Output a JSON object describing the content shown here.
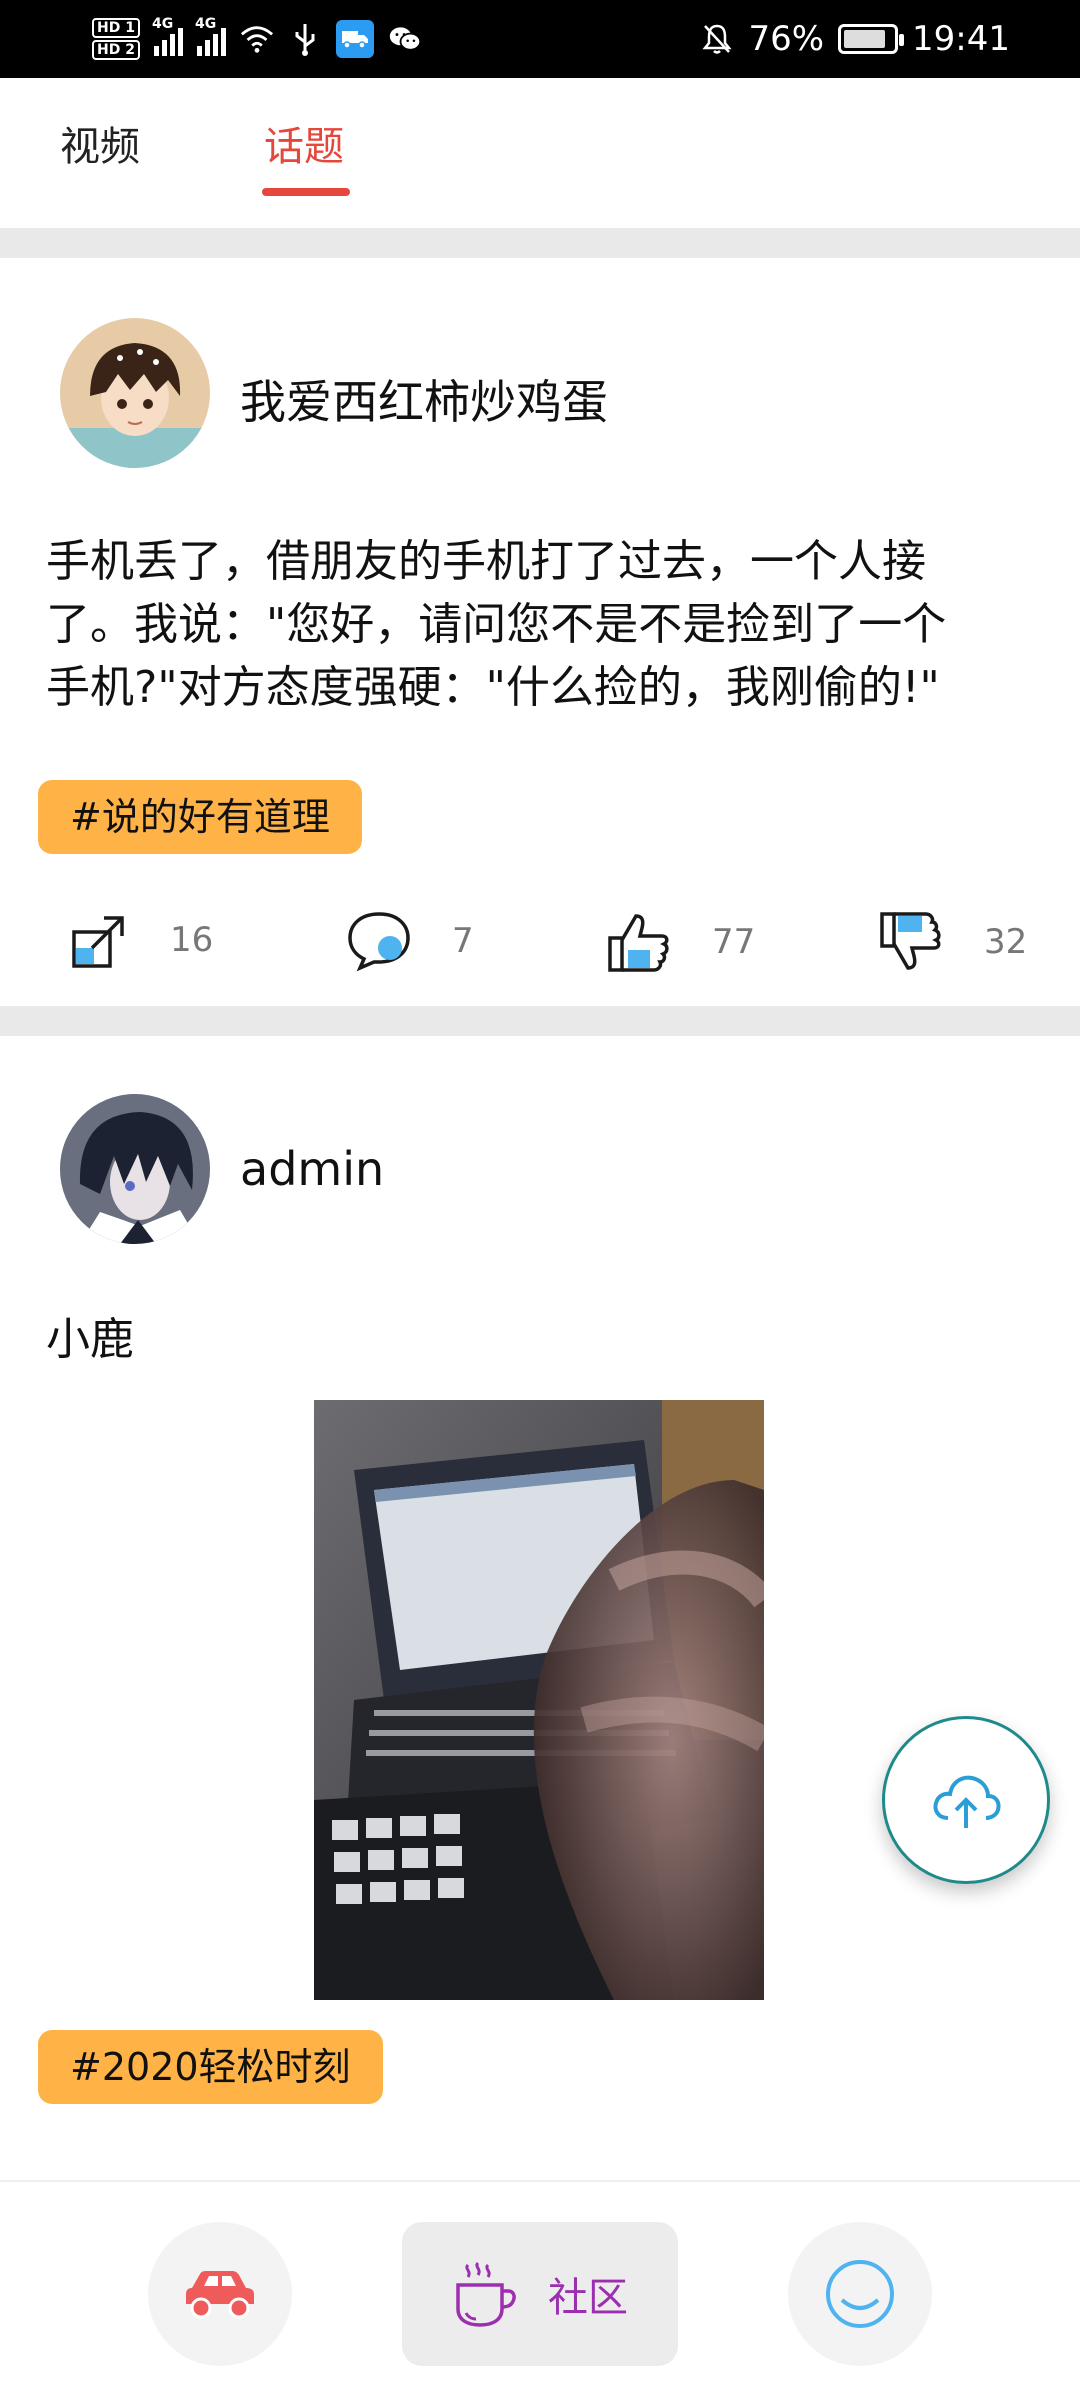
{
  "status_bar": {
    "battery_percent": "76%",
    "time": "19:41",
    "hd1": "HD 1",
    "hd2": "HD 2",
    "network1": "4G",
    "network2": "4G"
  },
  "tabs": [
    {
      "label": "视频",
      "active": false
    },
    {
      "label": "话题",
      "active": true
    }
  ],
  "posts": [
    {
      "username": "我爱西红柿炒鸡蛋",
      "lines": [
        "手机丢了，借朋友的手机打了过去，一个人接",
        "了。我说：\"您好，请问您不是不是捡到了一个",
        "手机?\"对方态度强硬：\"什么捡的，我刚偷的!\""
      ],
      "tag": "#说的好有道理",
      "share_count": "16",
      "comment_count": "7",
      "like_count": "77",
      "dislike_count": "32"
    },
    {
      "username": "admin",
      "text": "小鹿",
      "tag": "#2020轻松时刻"
    }
  ],
  "bottom_nav": {
    "community_label": "社区"
  },
  "colors": {
    "accent_red": "#e5473b",
    "tag_orange": "#ffb347",
    "icon_blue": "#4fb3f0",
    "community_purple": "#9b2fb0",
    "car_red": "#ef5b5b"
  }
}
